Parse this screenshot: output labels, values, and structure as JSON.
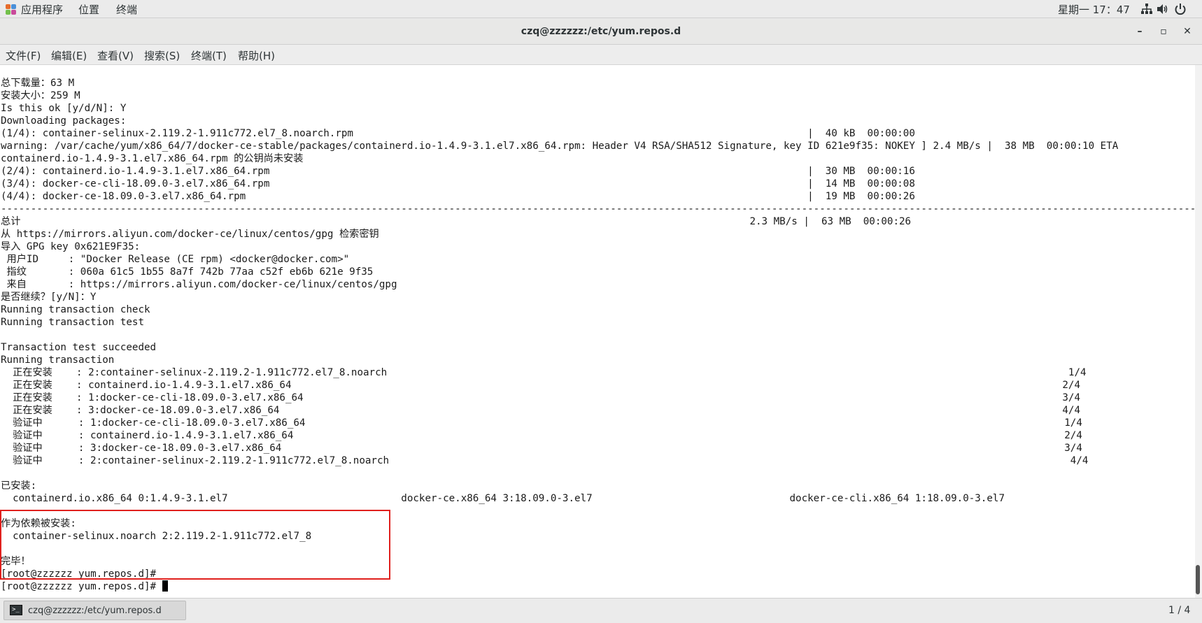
{
  "topbar": {
    "applications": "应用程序",
    "places": "位置",
    "terminal": "终端",
    "clock": "星期一 17：47",
    "icons": [
      "network-icon",
      "volume-icon",
      "power-icon"
    ]
  },
  "window": {
    "title": "czq@zzzzzz:/etc/yum.repos.d",
    "minimize": "–",
    "maximize": "▫",
    "close": "✕"
  },
  "menu": {
    "file": "文件(F)",
    "edit": "编辑(E)",
    "view": "查看(V)",
    "search": "搜索(S)",
    "terminal": "终端(T)",
    "help": "帮助(H)"
  },
  "terminal_output": "总下载量：63 M\n安装大小：259 M\nIs this ok [y/d/N]: Y\nDownloading packages:\n(1/4): container-selinux-2.119.2-1.911c772.el7_8.noarch.rpm                                                                            |  40 kB  00:00:00\nwarning: /var/cache/yum/x86_64/7/docker-ce-stable/packages/containerd.io-1.4.9-3.1.el7.x86_64.rpm: Header V4 RSA/SHA512 Signature, key ID 621e9f35: NOKEY ] 2.4 MB/s |  38 MB  00:00:10 ETA\ncontainerd.io-1.4.9-3.1.el7.x86_64.rpm 的公钥尚未安装\n(2/4): containerd.io-1.4.9-3.1.el7.x86_64.rpm                                                                                          |  30 MB  00:00:16\n(3/4): docker-ce-cli-18.09.0-3.el7.x86_64.rpm                                                                                          |  14 MB  00:00:08\n(4/4): docker-ce-18.09.0-3.el7.x86_64.rpm                                                                                              |  19 MB  00:00:26\n--------------------------------------------------------------------------------------------------------------------------------------------------------------------------------------------------------\n总计                                                                                                                          2.3 MB/s |  63 MB  00:00:26\n从 https://mirrors.aliyun.com/docker-ce/linux/centos/gpg 检索密钥\n导入 GPG key 0x621E9F35:\n 用户ID     : \"Docker Release (CE rpm) <docker@docker.com>\"\n 指纹       : 060a 61c5 1b55 8a7f 742b 77aa c52f eb6b 621e 9f35\n 来自       : https://mirrors.aliyun.com/docker-ce/linux/centos/gpg\n是否继续？[y/N]：Y\nRunning transaction check\nRunning transaction test\n\nTransaction test succeeded\nRunning transaction\n  正在安装    : 2:container-selinux-2.119.2-1.911c772.el7_8.noarch                                                                                                                  1/4\n  正在安装    : containerd.io-1.4.9-3.1.el7.x86_64                                                                                                                                 2/4\n  正在安装    : 1:docker-ce-cli-18.09.0-3.el7.x86_64                                                                                                                               3/4\n  正在安装    : 3:docker-ce-18.09.0-3.el7.x86_64                                                                                                                                   4/4\n  验证中      : 1:docker-ce-cli-18.09.0-3.el7.x86_64                                                                                                                               1/4\n  验证中      : containerd.io-1.4.9-3.1.el7.x86_64                                                                                                                                 2/4\n  验证中      : 3:docker-ce-18.09.0-3.el7.x86_64                                                                                                                                   3/4\n  验证中      : 2:container-selinux-2.119.2-1.911c772.el7_8.noarch                                                                                                                  4/4\n\n已安装:\n  containerd.io.x86_64 0:1.4.9-3.1.el7                             docker-ce.x86_64 3:18.09.0-3.el7                                 docker-ce-cli.x86_64 1:18.09.0-3.el7\n\n作为依赖被安装:\n  container-selinux.noarch 2:2.119.2-1.911c772.el7_8\n\n完毕！\n[root@zzzzzz yum.repos.d]# ",
  "prompt_line": "[root@zzzzzz yum.repos.d]# ",
  "taskbar": {
    "item": "czq@zzzzzz:/etc/yum.repos.d",
    "pager": "1 / 4"
  }
}
